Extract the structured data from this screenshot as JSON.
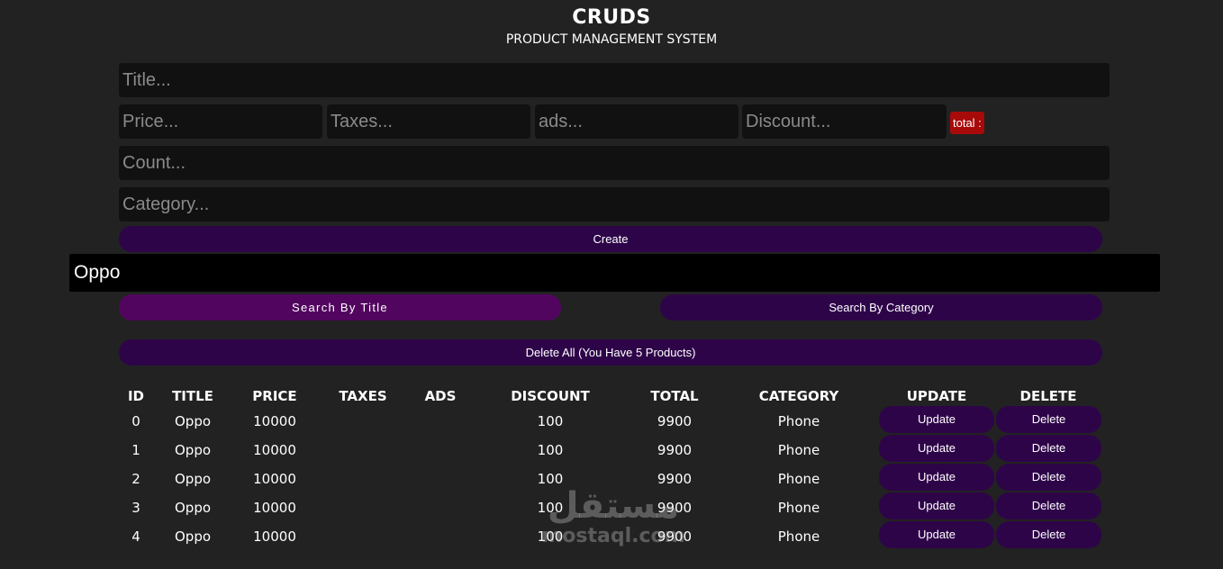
{
  "header": {
    "title": "CRUDS",
    "subtitle": "PRODUCT MANAGEMENT SYSTEM"
  },
  "form": {
    "title_placeholder": "Title...",
    "price_placeholder": "Price...",
    "taxes_placeholder": "Taxes...",
    "ads_placeholder": "ads...",
    "discount_placeholder": "Discount...",
    "total_label": "total :",
    "count_placeholder": "Count...",
    "category_placeholder": "Category...",
    "create_label": "Create"
  },
  "search": {
    "value": "Oppo",
    "by_title_label": "Search By Title",
    "by_category_label": "Search By Category"
  },
  "delete_all_label": "Delete All (You Have 5 Products)",
  "table": {
    "headers": [
      "ID",
      "TITLE",
      "PRICE",
      "TAXES",
      "ADS",
      "DISCOUNT",
      "TOTAL",
      "CATEGORY",
      "UPDATE",
      "DELETE"
    ],
    "rows": [
      {
        "id": "0",
        "title": "Oppo",
        "price": "10000",
        "taxes": "",
        "ads": "",
        "discount": "100",
        "total": "9900",
        "category": "Phone",
        "update": "Update",
        "delete": "Delete"
      },
      {
        "id": "1",
        "title": "Oppo",
        "price": "10000",
        "taxes": "",
        "ads": "",
        "discount": "100",
        "total": "9900",
        "category": "Phone",
        "update": "Update",
        "delete": "Delete"
      },
      {
        "id": "2",
        "title": "Oppo",
        "price": "10000",
        "taxes": "",
        "ads": "",
        "discount": "100",
        "total": "9900",
        "category": "Phone",
        "update": "Update",
        "delete": "Delete"
      },
      {
        "id": "3",
        "title": "Oppo",
        "price": "10000",
        "taxes": "",
        "ads": "",
        "discount": "100",
        "total": "9900",
        "category": "Phone",
        "update": "Update",
        "delete": "Delete"
      },
      {
        "id": "4",
        "title": "Oppo",
        "price": "10000",
        "taxes": "",
        "ads": "",
        "discount": "100",
        "total": "9900",
        "category": "Phone",
        "update": "Update",
        "delete": "Delete"
      }
    ]
  },
  "watermark": {
    "arabic": "مستقل",
    "latin": "mostaql.com"
  },
  "colors": {
    "background": "#222222",
    "input_bg": "#111111",
    "button_purple": "#2e0449",
    "button_active": "#52055f",
    "total_badge": "#a80a0a",
    "search_bg": "#000000"
  }
}
